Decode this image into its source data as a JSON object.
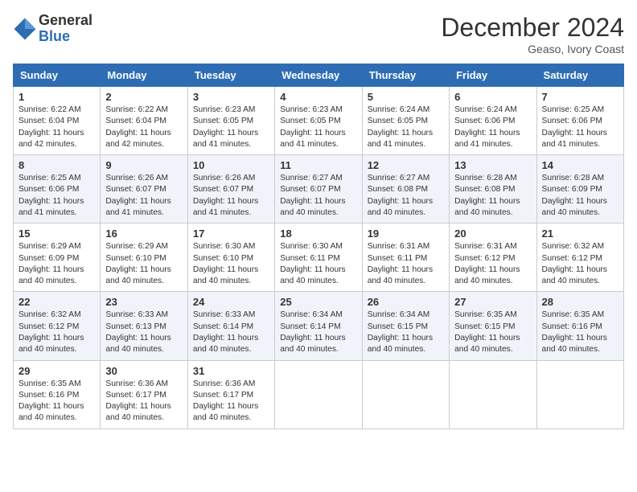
{
  "header": {
    "logo_general": "General",
    "logo_blue": "Blue",
    "title": "December 2024",
    "location": "Geaso, Ivory Coast"
  },
  "days_of_week": [
    "Sunday",
    "Monday",
    "Tuesday",
    "Wednesday",
    "Thursday",
    "Friday",
    "Saturday"
  ],
  "weeks": [
    [
      {
        "day": "1",
        "text": "Sunrise: 6:22 AM\nSunset: 6:04 PM\nDaylight: 11 hours\nand 42 minutes."
      },
      {
        "day": "2",
        "text": "Sunrise: 6:22 AM\nSunset: 6:04 PM\nDaylight: 11 hours\nand 42 minutes."
      },
      {
        "day": "3",
        "text": "Sunrise: 6:23 AM\nSunset: 6:05 PM\nDaylight: 11 hours\nand 41 minutes."
      },
      {
        "day": "4",
        "text": "Sunrise: 6:23 AM\nSunset: 6:05 PM\nDaylight: 11 hours\nand 41 minutes."
      },
      {
        "day": "5",
        "text": "Sunrise: 6:24 AM\nSunset: 6:05 PM\nDaylight: 11 hours\nand 41 minutes."
      },
      {
        "day": "6",
        "text": "Sunrise: 6:24 AM\nSunset: 6:06 PM\nDaylight: 11 hours\nand 41 minutes."
      },
      {
        "day": "7",
        "text": "Sunrise: 6:25 AM\nSunset: 6:06 PM\nDaylight: 11 hours\nand 41 minutes."
      }
    ],
    [
      {
        "day": "8",
        "text": "Sunrise: 6:25 AM\nSunset: 6:06 PM\nDaylight: 11 hours\nand 41 minutes."
      },
      {
        "day": "9",
        "text": "Sunrise: 6:26 AM\nSunset: 6:07 PM\nDaylight: 11 hours\nand 41 minutes."
      },
      {
        "day": "10",
        "text": "Sunrise: 6:26 AM\nSunset: 6:07 PM\nDaylight: 11 hours\nand 41 minutes."
      },
      {
        "day": "11",
        "text": "Sunrise: 6:27 AM\nSunset: 6:07 PM\nDaylight: 11 hours\nand 40 minutes."
      },
      {
        "day": "12",
        "text": "Sunrise: 6:27 AM\nSunset: 6:08 PM\nDaylight: 11 hours\nand 40 minutes."
      },
      {
        "day": "13",
        "text": "Sunrise: 6:28 AM\nSunset: 6:08 PM\nDaylight: 11 hours\nand 40 minutes."
      },
      {
        "day": "14",
        "text": "Sunrise: 6:28 AM\nSunset: 6:09 PM\nDaylight: 11 hours\nand 40 minutes."
      }
    ],
    [
      {
        "day": "15",
        "text": "Sunrise: 6:29 AM\nSunset: 6:09 PM\nDaylight: 11 hours\nand 40 minutes."
      },
      {
        "day": "16",
        "text": "Sunrise: 6:29 AM\nSunset: 6:10 PM\nDaylight: 11 hours\nand 40 minutes."
      },
      {
        "day": "17",
        "text": "Sunrise: 6:30 AM\nSunset: 6:10 PM\nDaylight: 11 hours\nand 40 minutes."
      },
      {
        "day": "18",
        "text": "Sunrise: 6:30 AM\nSunset: 6:11 PM\nDaylight: 11 hours\nand 40 minutes."
      },
      {
        "day": "19",
        "text": "Sunrise: 6:31 AM\nSunset: 6:11 PM\nDaylight: 11 hours\nand 40 minutes."
      },
      {
        "day": "20",
        "text": "Sunrise: 6:31 AM\nSunset: 6:12 PM\nDaylight: 11 hours\nand 40 minutes."
      },
      {
        "day": "21",
        "text": "Sunrise: 6:32 AM\nSunset: 6:12 PM\nDaylight: 11 hours\nand 40 minutes."
      }
    ],
    [
      {
        "day": "22",
        "text": "Sunrise: 6:32 AM\nSunset: 6:12 PM\nDaylight: 11 hours\nand 40 minutes."
      },
      {
        "day": "23",
        "text": "Sunrise: 6:33 AM\nSunset: 6:13 PM\nDaylight: 11 hours\nand 40 minutes."
      },
      {
        "day": "24",
        "text": "Sunrise: 6:33 AM\nSunset: 6:14 PM\nDaylight: 11 hours\nand 40 minutes."
      },
      {
        "day": "25",
        "text": "Sunrise: 6:34 AM\nSunset: 6:14 PM\nDaylight: 11 hours\nand 40 minutes."
      },
      {
        "day": "26",
        "text": "Sunrise: 6:34 AM\nSunset: 6:15 PM\nDaylight: 11 hours\nand 40 minutes."
      },
      {
        "day": "27",
        "text": "Sunrise: 6:35 AM\nSunset: 6:15 PM\nDaylight: 11 hours\nand 40 minutes."
      },
      {
        "day": "28",
        "text": "Sunrise: 6:35 AM\nSunset: 6:16 PM\nDaylight: 11 hours\nand 40 minutes."
      }
    ],
    [
      {
        "day": "29",
        "text": "Sunrise: 6:35 AM\nSunset: 6:16 PM\nDaylight: 11 hours\nand 40 minutes."
      },
      {
        "day": "30",
        "text": "Sunrise: 6:36 AM\nSunset: 6:17 PM\nDaylight: 11 hours\nand 40 minutes."
      },
      {
        "day": "31",
        "text": "Sunrise: 6:36 AM\nSunset: 6:17 PM\nDaylight: 11 hours\nand 40 minutes."
      },
      null,
      null,
      null,
      null
    ]
  ]
}
